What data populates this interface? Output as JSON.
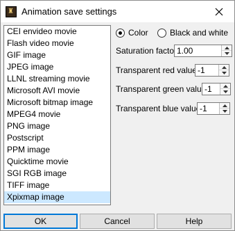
{
  "window": {
    "title": "Animation save settings"
  },
  "formats": [
    "CEI envideo movie",
    "Flash video movie",
    "GIF image",
    "JPEG image",
    "LLNL streaming movie",
    "Microsoft AVI movie",
    "Microsoft bitmap image",
    "MPEG4 movie",
    "PNG image",
    "Postscript",
    "PPM image",
    "Quicktime movie",
    "SGI RGB image",
    "TIFF image",
    "Xpixmap image"
  ],
  "selected_format": "Xpixmap image",
  "color_mode": {
    "color_label": "Color",
    "bw_label": "Black and white",
    "selected": "Color"
  },
  "saturation": {
    "label": "Saturation factor",
    "value": "1.00"
  },
  "transparent_red": {
    "label": "Transparent red value",
    "value": "-1"
  },
  "transparent_green": {
    "label": "Transparent green value",
    "value": "-1"
  },
  "transparent_blue": {
    "label": "Transparent blue value",
    "value": "-1"
  },
  "buttons": {
    "ok": "OK",
    "cancel": "Cancel",
    "help": "Help"
  },
  "colors": {
    "selection": "#cce8ff",
    "default_button_border": "#0078d7"
  }
}
